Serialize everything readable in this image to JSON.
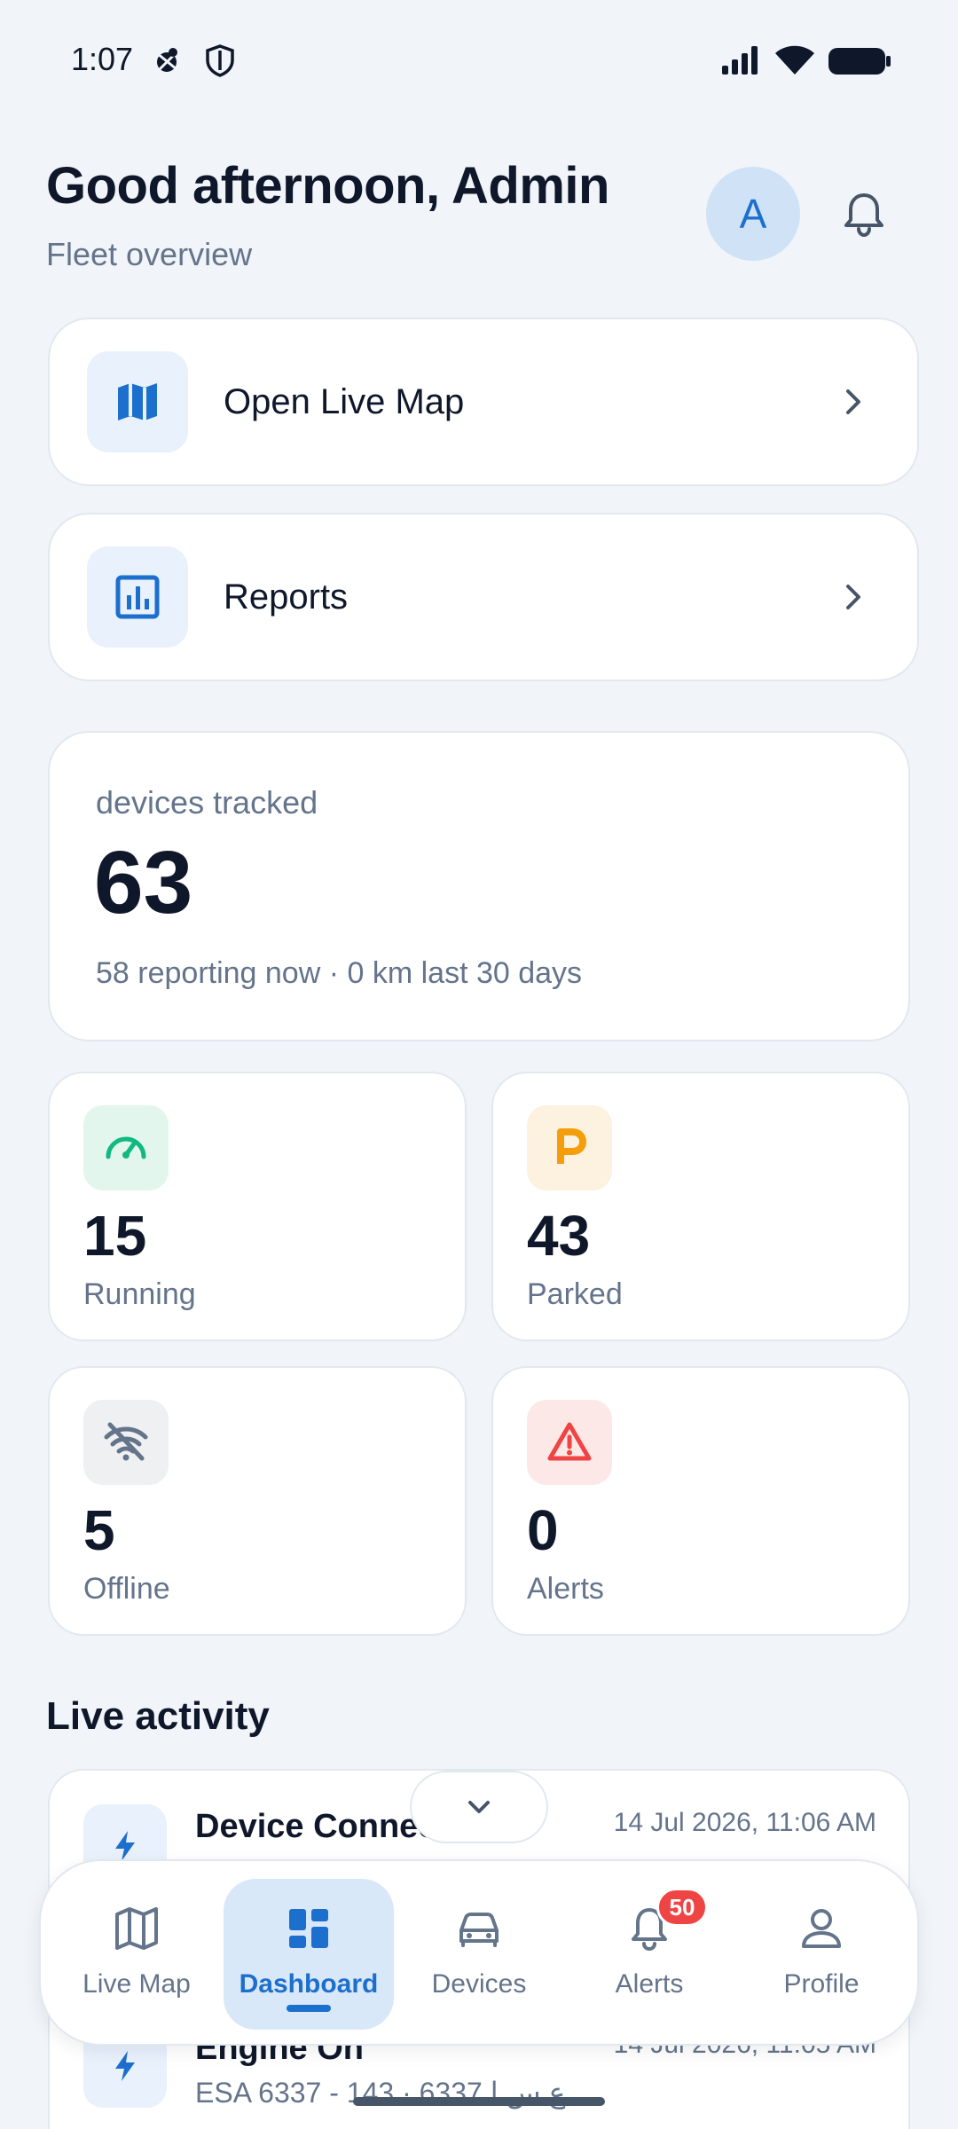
{
  "status_bar": {
    "time": "1:07",
    "icons": [
      "app-notification-icon",
      "shield-icon",
      "signal-icon",
      "wifi-icon",
      "battery-icon"
    ]
  },
  "header": {
    "greeting": "Good afternoon, Admin",
    "subtitle": "Fleet overview",
    "avatar_initial": "A"
  },
  "nav_cards": [
    {
      "label": "Open Live Map",
      "icon": "map-icon"
    },
    {
      "label": "Reports",
      "icon": "bar-chart-icon"
    }
  ],
  "summary": {
    "label": "devices tracked",
    "count": "63",
    "footer": "58 reporting now · 0 km last 30 days"
  },
  "stats": [
    {
      "value": "15",
      "label": "Running",
      "icon": "speedometer-icon",
      "color": "#10b981",
      "bg": "#e3f6ee"
    },
    {
      "value": "43",
      "label": "Parked",
      "icon": "parking-icon",
      "color": "#f59e0b",
      "bg": "#fdf1df"
    },
    {
      "value": "5",
      "label": "Offline",
      "icon": "wifi-off-icon",
      "color": "#64748b",
      "bg": "#eef0f2"
    },
    {
      "value": "0",
      "label": "Alerts",
      "icon": "warning-icon",
      "color": "#ef4444",
      "bg": "#fde8e8"
    }
  ],
  "live_activity": {
    "title": "Live activity",
    "items": [
      {
        "title": "Device Connec",
        "time": "14 Jul 2026, 11:06 AM",
        "subtitle": ""
      },
      {
        "title": "Engine On",
        "time": "14 Jul 2026, 11:05 AM",
        "subtitle": "ESA 6337 - 143 · 6337 ع س ا"
      }
    ]
  },
  "bottom_nav": {
    "items": [
      {
        "label": "Live Map",
        "icon": "map-icon",
        "active": false
      },
      {
        "label": "Dashboard",
        "icon": "dashboard-icon",
        "active": true
      },
      {
        "label": "Devices",
        "icon": "car-icon",
        "active": false
      },
      {
        "label": "Alerts",
        "icon": "bell-icon",
        "active": false,
        "badge": "50"
      },
      {
        "label": "Profile",
        "icon": "person-icon",
        "active": false
      }
    ]
  },
  "colors": {
    "accent": "#1d6fce",
    "background": "#f1f5f9",
    "text": "#0f172a",
    "muted": "#64748b"
  }
}
